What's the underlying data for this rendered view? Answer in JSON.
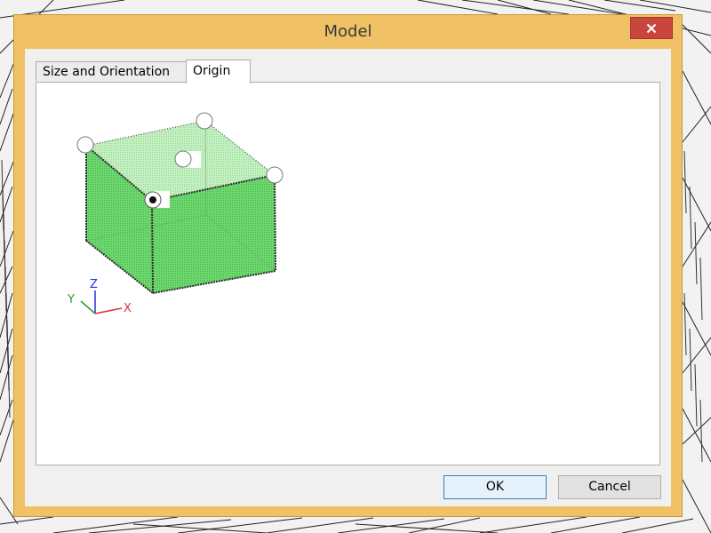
{
  "window": {
    "title": "Model",
    "close_icon": "close-icon"
  },
  "tabs": [
    {
      "label": "Size and Orientation",
      "selected": false
    },
    {
      "label": "Origin",
      "selected": true
    }
  ],
  "axes": {
    "x": "X",
    "y": "Y",
    "z": "Z"
  },
  "origin_point_options": [
    {
      "name": "top-back-left",
      "selected": false
    },
    {
      "name": "top-back-right",
      "selected": false
    },
    {
      "name": "top-front-left",
      "selected": false
    },
    {
      "name": "top-front-right",
      "selected": false
    },
    {
      "name": "top-center",
      "selected": false
    },
    {
      "name": "bottom-front-left",
      "selected": true
    }
  ],
  "buttons": {
    "ok": "OK",
    "cancel": "Cancel"
  },
  "colors": {
    "titlebar": "#f0c165",
    "close_button": "#c9463d",
    "cube_side": "#66d46a",
    "cube_top": "#b4ebb2",
    "axis_x": "#e03030",
    "axis_y": "#2a9a2a",
    "axis_z": "#2a2ae0"
  }
}
